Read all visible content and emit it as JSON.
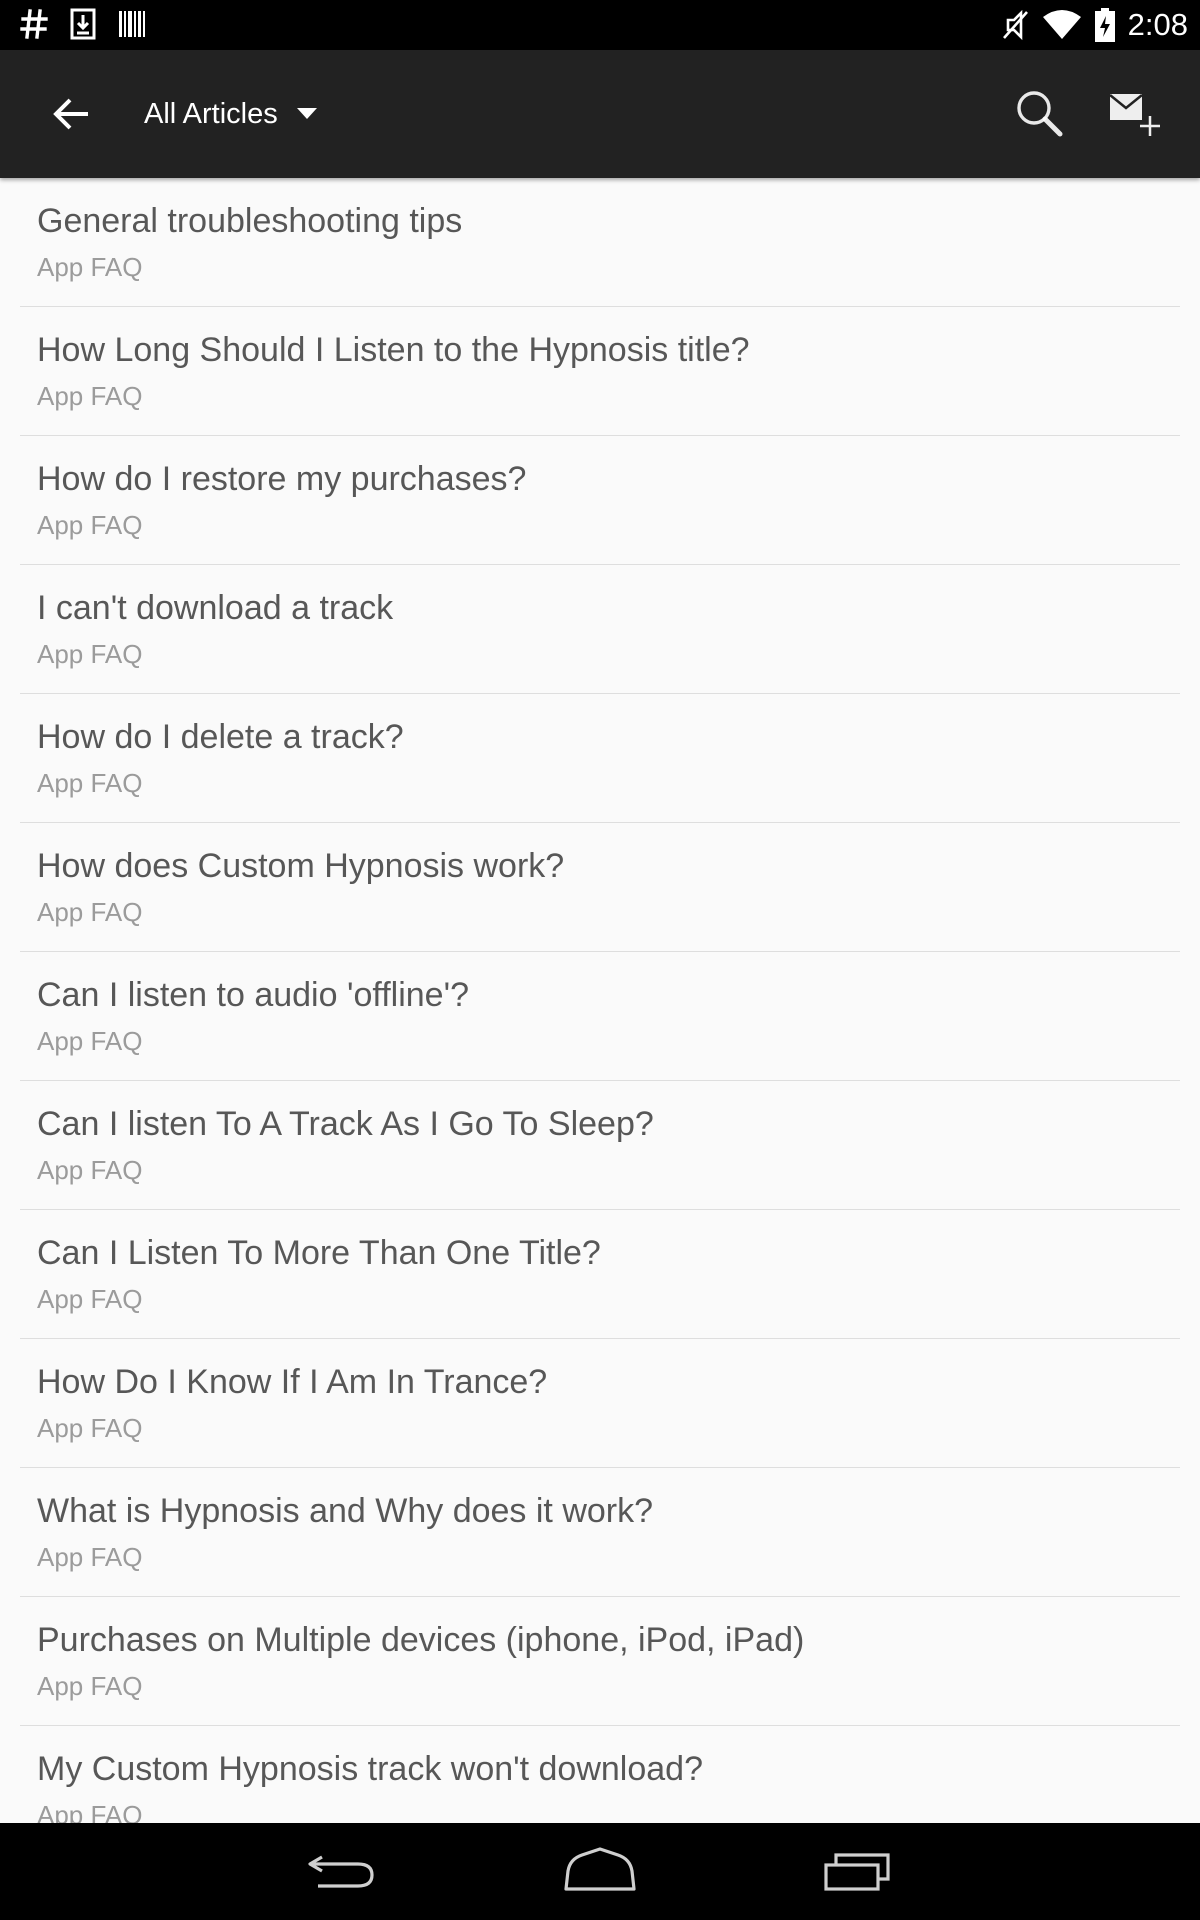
{
  "status_bar": {
    "time": "2:08",
    "left_icons": [
      "hash-icon",
      "download-icon",
      "barcode-icon"
    ],
    "right_icons": [
      "mute-icon",
      "wifi-icon",
      "battery-charging-icon"
    ]
  },
  "action_bar": {
    "title": "All Articles",
    "icons": [
      "back-arrow-icon",
      "dropdown-triangle-icon",
      "search-icon",
      "compose-mail-icon"
    ]
  },
  "articles": [
    {
      "title": "General troubleshooting tips",
      "category": "App FAQ"
    },
    {
      "title": "How Long Should I Listen to the Hypnosis title?",
      "category": "App FAQ"
    },
    {
      "title": "How do I restore my purchases?",
      "category": "App FAQ"
    },
    {
      "title": "I can't download a track",
      "category": "App FAQ"
    },
    {
      "title": "How do I delete a track?",
      "category": "App FAQ"
    },
    {
      "title": "How does Custom Hypnosis work?",
      "category": "App FAQ"
    },
    {
      "title": "Can I listen to audio 'offline'?",
      "category": "App FAQ"
    },
    {
      "title": "Can I listen To A Track As I Go To Sleep?",
      "category": "App FAQ"
    },
    {
      "title": "Can I Listen To More Than One Title?",
      "category": "App FAQ"
    },
    {
      "title": "How Do I Know If I Am In Trance?",
      "category": "App FAQ"
    },
    {
      "title": "What is Hypnosis and Why does it work?",
      "category": "App FAQ"
    },
    {
      "title": "Purchases on Multiple devices (iphone, iPod, iPad)",
      "category": "App FAQ"
    },
    {
      "title": "My Custom Hypnosis track won't download?",
      "category": "App FAQ"
    }
  ],
  "nav_bar": {
    "icons": [
      "nav-back-icon",
      "nav-home-icon",
      "nav-recents-icon"
    ]
  },
  "colors": {
    "status_bar_bg": "#000000",
    "action_bar_bg": "#222222",
    "list_bg": "#fafafa",
    "title_text": "#575757",
    "subtitle_text": "#9b9b9b",
    "divider": "#dedede"
  }
}
